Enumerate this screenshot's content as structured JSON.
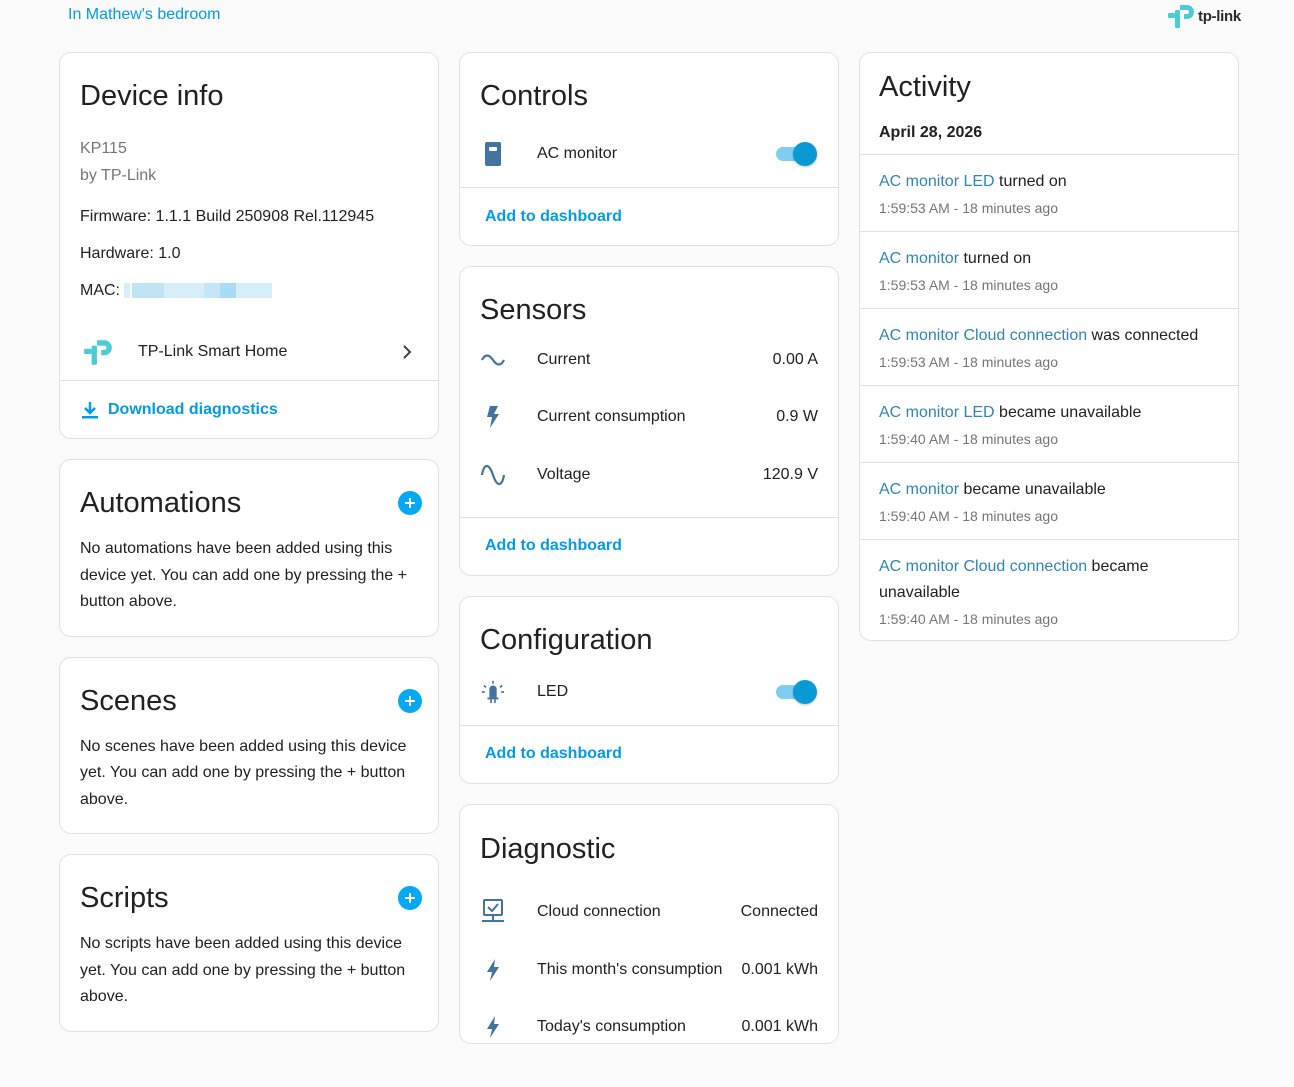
{
  "header": {
    "area": "In Mathew's bedroom",
    "brand": "tp-link"
  },
  "device_info": {
    "title": "Device info",
    "model": "KP115",
    "manufacturer": "by TP-Link",
    "firmware": "Firmware: 1.1.1 Build 250908 Rel.112945",
    "hardware": "Hardware: 1.0",
    "mac_label": "MAC:",
    "integration": "TP-Link Smart Home",
    "download": "Download diagnostics"
  },
  "automations": {
    "title": "Automations",
    "text": "No automations have been added using this device yet. You can add one by pressing the + button above."
  },
  "scenes": {
    "title": "Scenes",
    "text": "No scenes have been added using this device yet. You can add one by pressing the + button above."
  },
  "scripts": {
    "title": "Scripts",
    "text": "No scripts have been added using this device yet. You can add one by pressing the + button above."
  },
  "controls": {
    "title": "Controls",
    "entity": "AC monitor",
    "state": "on",
    "add": "Add to dashboard"
  },
  "sensors": {
    "title": "Sensors",
    "rows": [
      {
        "name": "Current",
        "value": "0.00 A",
        "icon": "current-ac-icon"
      },
      {
        "name": "Current consumption",
        "value": "0.9 W",
        "icon": "flash-icon"
      },
      {
        "name": "Voltage",
        "value": "120.9 V",
        "icon": "sine-wave-icon"
      }
    ],
    "add": "Add to dashboard"
  },
  "configuration": {
    "title": "Configuration",
    "entity": "LED",
    "state": "on",
    "add": "Add to dashboard"
  },
  "diagnostic": {
    "title": "Diagnostic",
    "rows": [
      {
        "name": "Cloud connection",
        "value": "Connected",
        "icon": "cloud-check-icon"
      },
      {
        "name": "This month's consumption",
        "value": "0.001 kWh",
        "icon": "flash-icon"
      },
      {
        "name": "Today's consumption",
        "value": "0.001 kWh",
        "icon": "flash-icon"
      }
    ]
  },
  "activity": {
    "title": "Activity",
    "date": "April 28, 2026",
    "items": [
      {
        "entity": "AC monitor LED",
        "action": " turned on",
        "time": "1:59:53 AM - 18 minutes ago"
      },
      {
        "entity": "AC monitor",
        "action": " turned on",
        "time": "1:59:53 AM - 18 minutes ago"
      },
      {
        "entity": "AC monitor Cloud connection",
        "action": " was connected",
        "time": "1:59:53 AM - 18 minutes ago"
      },
      {
        "entity": "AC monitor LED",
        "action": " became unavailable",
        "time": "1:59:40 AM - 18 minutes ago"
      },
      {
        "entity": "AC monitor",
        "action": " became unavailable",
        "time": "1:59:40 AM - 18 minutes ago"
      },
      {
        "entity": "AC monitor Cloud connection",
        "action": " became unavailable",
        "time": "1:59:40 AM - 18 minutes ago"
      }
    ]
  },
  "colors": {
    "accent": "#039be5",
    "toggle": "#0a99d4",
    "entity_link": "#2f86b6",
    "logo": "#4acbd6"
  }
}
